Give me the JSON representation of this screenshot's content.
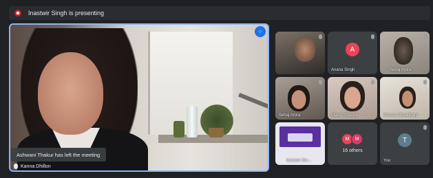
{
  "topbar": {
    "presenting_text": "Inastwir Singh is presenting"
  },
  "main": {
    "toast": "Ashwani Thakur has left the meeting",
    "speaker_name": "Kanna Dhillon"
  },
  "tiles": [
    {
      "name": "",
      "kind": "camera"
    },
    {
      "name": "Anana Singh",
      "kind": "avatar",
      "initial": "A",
      "color": "#e8445a"
    },
    {
      "name": "Sehaj Arora",
      "kind": "camera"
    },
    {
      "name": "Sehaj Arora",
      "kind": "camera"
    },
    {
      "name": "Mansi Sharma",
      "kind": "camera"
    },
    {
      "name": "Simran Chaudhary",
      "kind": "camera"
    },
    {
      "name": "Inastwir Sin...",
      "kind": "presentation"
    },
    {
      "name": "16 others",
      "kind": "others",
      "initials": [
        "M",
        "M"
      ],
      "colors": [
        "#e8445a",
        "#d93a6a"
      ]
    },
    {
      "name": "You",
      "kind": "avatar",
      "initial": "T",
      "color": "#5f7c8a"
    }
  ],
  "colors": {
    "accent": "#8ab4f8",
    "background": "#202124",
    "tile": "#3c4043"
  }
}
